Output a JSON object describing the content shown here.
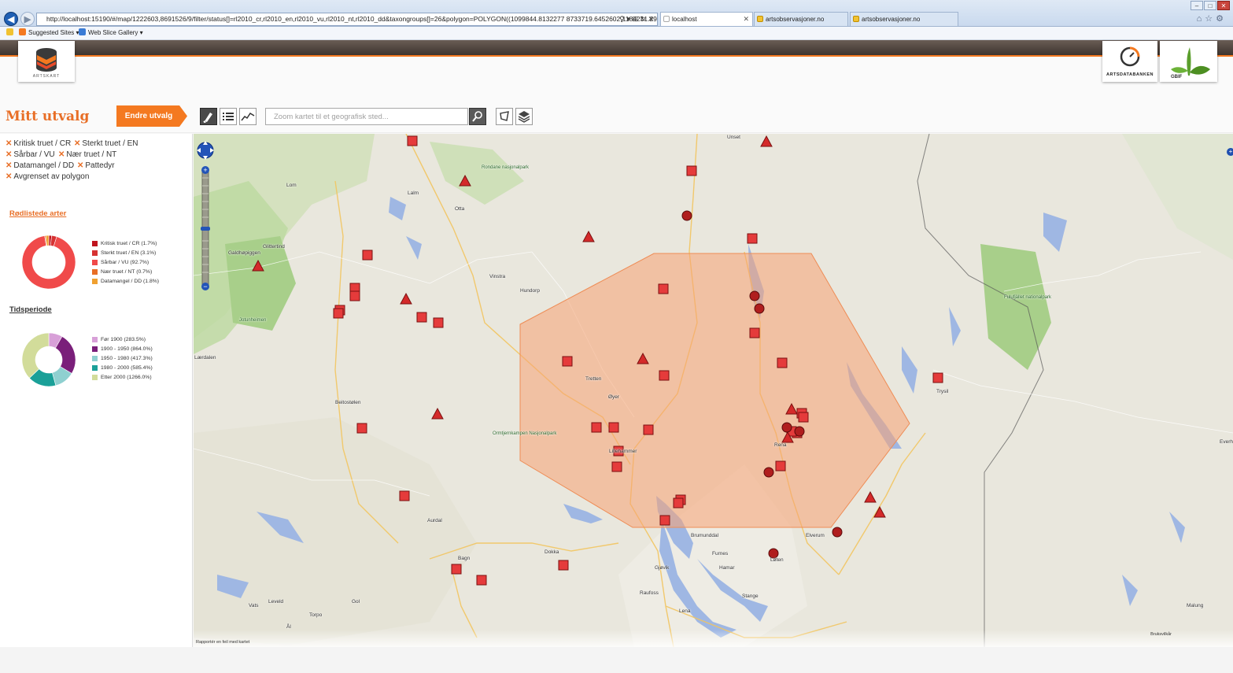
{
  "browser": {
    "url": "http://localhost:15190/#/map/1222603,8691526/9/filter/status[]=rl2010_cr,rl2010_en,rl2010_vu,rl2010_nt,rl2010_dd&taxongroups[]=26&polygon=POLYGON((1099844.8132277 8733719.6452602,1184231.2924395 8778053.1216576,1",
    "tabs": [
      {
        "label": "localhost"
      },
      {
        "label": "artsobservasjoner.no"
      },
      {
        "label": "artsobservasjoner.no"
      }
    ],
    "favorites": [
      "Suggested Sites ▾",
      "Web Slice Gallery ▾"
    ],
    "colors": {
      "back": "#1f5fb4",
      "accent": "#f47920"
    }
  },
  "header": {
    "artskart_label": "ARTSKART",
    "artsdatabanken_label": "ARTSDATABANKEN",
    "gbif_label": "GBIF"
  },
  "toolbar": {
    "title": "Mitt utvalg",
    "endre_label": "Endre utvalg",
    "search_placeholder": "Zoom kartet til et geografisk sted...",
    "icons": [
      "brush-icon",
      "list-icon",
      "chart-icon",
      "search-pin-icon",
      "polygon-icon",
      "layers-icon"
    ],
    "accent": "#f47920"
  },
  "filters": [
    [
      "Kritisk truet / CR",
      "Sterkt truet / EN"
    ],
    [
      "Sårbar / VU",
      "Nær truet / NT"
    ],
    [
      "Datamangel / DD",
      "Pattedyr"
    ],
    [
      "Avgrenset av polygon"
    ]
  ],
  "redlist": {
    "title": "Rødlistede arter",
    "items": [
      {
        "label": "Kritisk truet / CR (1.7%)",
        "value": 1.7,
        "color": "#c0141e"
      },
      {
        "label": "Sterkt truet / EN (3.1%)",
        "value": 3.1,
        "color": "#d63232"
      },
      {
        "label": "Sårbar / VU (92.7%)",
        "value": 92.7,
        "color": "#f04a4a"
      },
      {
        "label": "Nær truet / NT (0.7%)",
        "value": 0.7,
        "color": "#e86e26"
      },
      {
        "label": "Datamangel / DD (1.8%)",
        "value": 1.8,
        "color": "#f0a030"
      }
    ]
  },
  "period": {
    "title": "Tidsperiode",
    "items": [
      {
        "label": "Før 1900 (283.5%)",
        "value": 283.5,
        "color": "#d8a0d8"
      },
      {
        "label": "1900 - 1950 (864.0%)",
        "value": 864.0,
        "color": "#7a1f7a"
      },
      {
        "label": "1950 - 1980 (417.3%)",
        "value": 417.3,
        "color": "#8fd0d0"
      },
      {
        "label": "1980 - 2000 (585.4%)",
        "value": 585.4,
        "color": "#1aa098"
      },
      {
        "label": "Etter 2000 (1266.0%)",
        "value": 1266.0,
        "color": "#d2dc9a"
      }
    ]
  },
  "map": {
    "places": [
      "Unset",
      "Rondane nasjonalpark",
      "Lom",
      "Lalm",
      "Otta",
      "Galdhøpiggen",
      "Glittertind",
      "Jotunheimen",
      "Vinstra",
      "Hundorp",
      "Tretten",
      "Øyer",
      "Beitostølen",
      "Ormtjernkampen Nasjonalpark",
      "Lillehammer",
      "Rena",
      "Fulufjället nationalpark",
      "Trysil",
      "Aurdal",
      "Bagn",
      "Dokka",
      "Brumunddal",
      "Furnes",
      "Hamar",
      "Løten",
      "Elverum",
      "Gjøvik",
      "Raufoss",
      "Stange",
      "Lena",
      "Leveld",
      "Torpo",
      "Gol",
      "Vats",
      "Ål",
      "Lærdalen",
      "Everh",
      "Malung",
      "Rapportér en feil med kartet",
      "Bruksvilkår"
    ],
    "colors": {
      "marker": "#e53b3b",
      "marker_border": "#7a1010",
      "circle": "#b01e1e",
      "polygon": "#f4a070"
    }
  }
}
